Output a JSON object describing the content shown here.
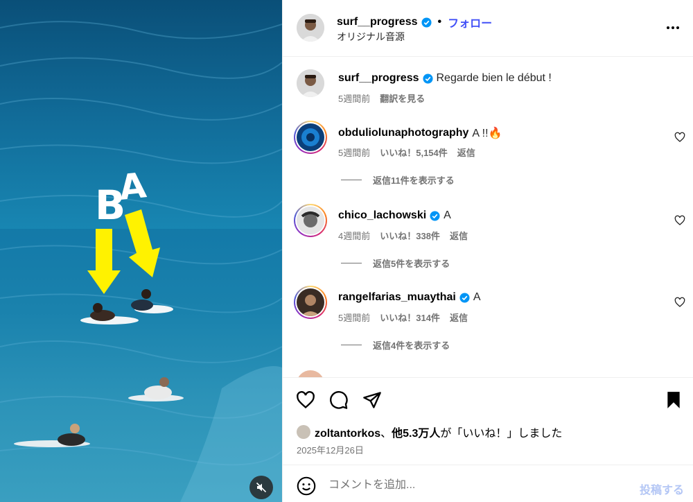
{
  "media": {
    "overlay_letters": [
      "B",
      "A"
    ],
    "mute_icon": "muted-speaker-icon",
    "arrow_color": "#fff200"
  },
  "header": {
    "username": "surf__progress",
    "separator": "•",
    "follow_label": "フォロー",
    "audio_label": "オリジナル音源",
    "more_icon": "more-horizontal-icon"
  },
  "caption": {
    "username": "surf__progress",
    "text": "Regarde bien le début !",
    "time": "5週間前",
    "translate": "翻訳を見る"
  },
  "comments": [
    {
      "username": "obduliolunaphotography",
      "text": "A !!🔥",
      "time": "5週間前",
      "likes": "いいね！5,154件",
      "reply": "返信",
      "view_replies": "返信11件を表示する"
    },
    {
      "username": "chico_lachowski",
      "text": "A",
      "time": "4週間前",
      "likes": "いいね！338件",
      "reply": "返信",
      "view_replies": "返信5件を表示する"
    },
    {
      "username": "rangelfarias_muaythai",
      "text": "A",
      "time": "5週間前",
      "likes": "いいね！314件",
      "reply": "返信",
      "view_replies": "返信4件を表示する"
    }
  ],
  "actions": {
    "liked_by_user": "zoltantorkos",
    "liked_by_sep": "、",
    "liked_by_others": "他5.3万人",
    "liked_by_suffix": "が「いいね！」しました",
    "date": "2025年12月26日"
  },
  "composer": {
    "placeholder": "コメントを追加...",
    "post_label": "投稿する"
  },
  "colors": {
    "accent": "#4150f7",
    "verified": "#0095f6",
    "muted_text": "#737373",
    "post_disabled": "#b3c6f5"
  }
}
